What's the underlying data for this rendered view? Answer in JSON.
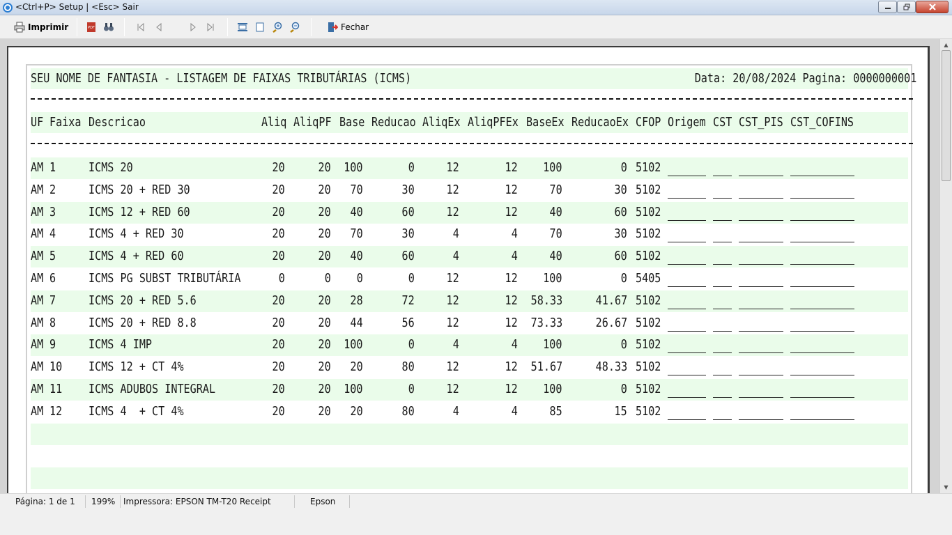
{
  "window": {
    "title": "<Ctrl+P> Setup | <Esc> Sair"
  },
  "toolbar": {
    "print_label": "Imprimir",
    "close_label": "Fechar"
  },
  "report": {
    "title": "SEU NOME DE FANTASIA - LISTAGEM DE FAIXAS TRIBUTÁRIAS (ICMS)",
    "date_page": "Data: 20/08/2024 Pagina: 0000000001",
    "dashes": "--------------------------------------------------------------------------------------------------------------------------------------------",
    "columns": [
      "UF",
      "Faixa",
      "Descricao",
      "Aliq",
      "AliqPF",
      "Base",
      "Reducao",
      "AliqEx",
      "AliqPFEx",
      "BaseEx",
      "ReducaoEx",
      "CFOP",
      "Origem",
      "CST",
      "CST_PIS",
      "CST_COFINS"
    ],
    "rows": [
      [
        "AM",
        "1",
        "ICMS 20",
        "20",
        "20",
        "100",
        "0",
        "12",
        "12",
        "100",
        "0",
        "5102"
      ],
      [
        "AM",
        "2",
        "ICMS 20 + RED 30",
        "20",
        "20",
        "70",
        "30",
        "12",
        "12",
        "70",
        "30",
        "5102"
      ],
      [
        "AM",
        "3",
        "ICMS 12 + RED 60",
        "20",
        "20",
        "40",
        "60",
        "12",
        "12",
        "40",
        "60",
        "5102"
      ],
      [
        "AM",
        "4",
        "ICMS 4 + RED 30",
        "20",
        "20",
        "70",
        "30",
        "4",
        "4",
        "70",
        "30",
        "5102"
      ],
      [
        "AM",
        "5",
        "ICMS 4 + RED 60",
        "20",
        "20",
        "40",
        "60",
        "4",
        "4",
        "40",
        "60",
        "5102"
      ],
      [
        "AM",
        "6",
        "ICMS PG SUBST TRIBUTÁRIA",
        "0",
        "0",
        "0",
        "0",
        "12",
        "12",
        "100",
        "0",
        "5405"
      ],
      [
        "AM",
        "7",
        "ICMS 20 + RED 5.6",
        "20",
        "20",
        "28",
        "72",
        "12",
        "12",
        "58.33",
        "41.67",
        "5102"
      ],
      [
        "AM",
        "8",
        "ICMS 20 + RED 8.8",
        "20",
        "20",
        "44",
        "56",
        "12",
        "12",
        "73.33",
        "26.67",
        "5102"
      ],
      [
        "AM",
        "9",
        "ICMS 4 IMP",
        "20",
        "20",
        "100",
        "0",
        "4",
        "4",
        "100",
        "0",
        "5102"
      ],
      [
        "AM",
        "10",
        "ICMS 12 + CT 4%",
        "20",
        "20",
        "20",
        "80",
        "12",
        "12",
        "51.67",
        "48.33",
        "5102"
      ],
      [
        "AM",
        "11",
        "ICMS ADUBOS INTEGRAL",
        "20",
        "20",
        "100",
        "0",
        "12",
        "12",
        "100",
        "0",
        "5102"
      ],
      [
        "AM",
        "12",
        "ICMS 4  + CT 4%",
        "20",
        "20",
        "20",
        "80",
        "4",
        "4",
        "85",
        "15",
        "5102"
      ]
    ]
  },
  "statusbar": {
    "page": "Página: 1 de 1",
    "zoom": "199%",
    "printer": "Impressora: EPSON TM-T20 Receipt",
    "brand": "Epson"
  },
  "colors": {
    "band": "#eafcea",
    "titlebar": "#c7d6ea"
  }
}
